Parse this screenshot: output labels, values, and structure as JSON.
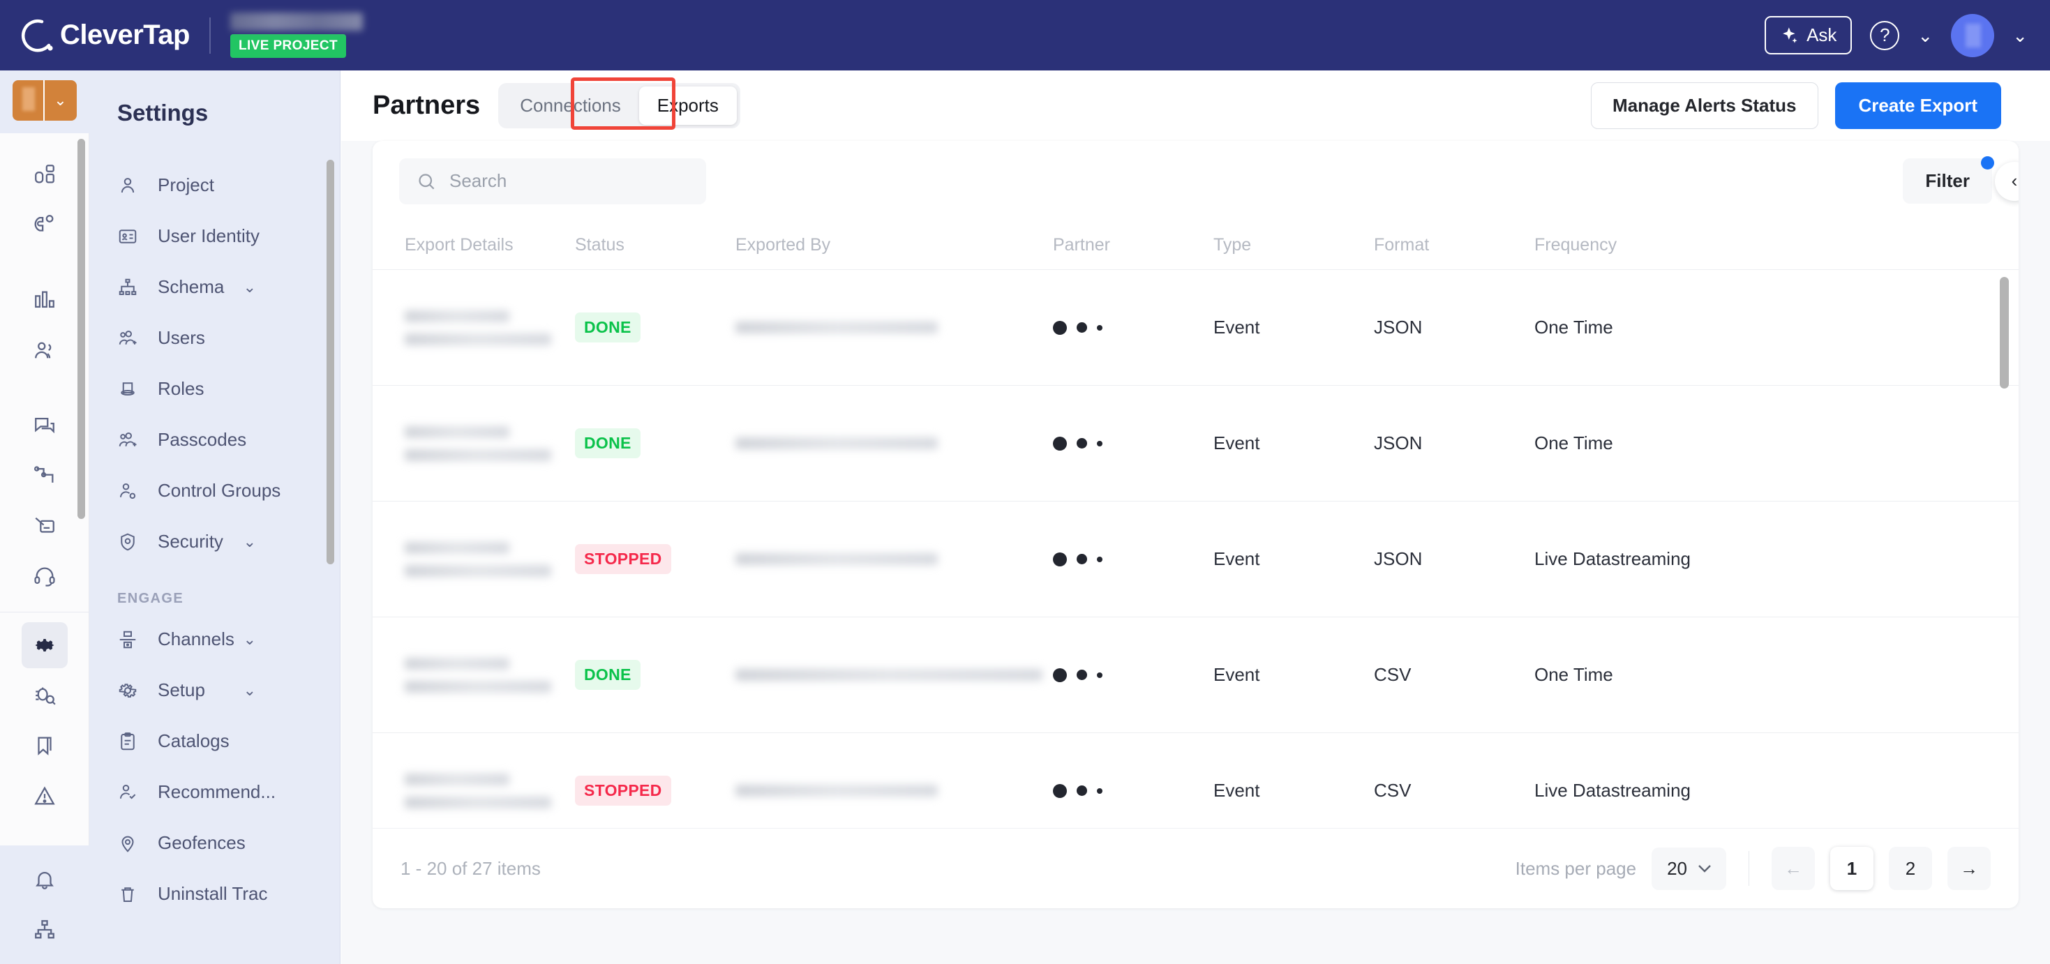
{
  "topbar": {
    "brand": "CleverTap",
    "project_badge": "LIVE PROJECT",
    "ask_label": "Ask",
    "icons": {
      "sparkle": "sparkle-icon",
      "help": "?",
      "chevron": "˅"
    }
  },
  "settings_sidebar": {
    "title": "Settings",
    "items": [
      {
        "label": "Project",
        "icon": "user-icon",
        "expandable": false
      },
      {
        "label": "User Identity",
        "icon": "id-card-icon",
        "expandable": false
      },
      {
        "label": "Schema",
        "icon": "schema-icon",
        "expandable": true
      },
      {
        "label": "Users",
        "icon": "users-add-icon",
        "expandable": false
      },
      {
        "label": "Roles",
        "icon": "hat-icon",
        "expandable": false
      },
      {
        "label": "Passcodes",
        "icon": "users-add-icon",
        "expandable": false
      },
      {
        "label": "Control Groups",
        "icon": "user-gear-icon",
        "expandable": false
      },
      {
        "label": "Security",
        "icon": "shield-lock-icon",
        "expandable": true
      }
    ],
    "group_label": "ENGAGE",
    "engage_items": [
      {
        "label": "Channels",
        "icon": "channels-icon",
        "expandable": true
      },
      {
        "label": "Setup",
        "icon": "gear-icon",
        "expandable": true
      },
      {
        "label": "Catalogs",
        "icon": "clipboard-icon",
        "expandable": false
      },
      {
        "label": "Recommend...",
        "icon": "user-check-icon",
        "expandable": false
      },
      {
        "label": "Geofences",
        "icon": "map-pin-icon",
        "expandable": false
      },
      {
        "label": "Uninstall Trac",
        "icon": "trash-icon",
        "expandable": false
      }
    ]
  },
  "rail": {
    "icons": [
      "dashboard-icon",
      "magnet-icon",
      "bar-chart-icon",
      "people-icon",
      "messages-icon",
      "flow-icon",
      "campaign-icon",
      "headset-icon"
    ],
    "bottom_icons": [
      "gear-icon",
      "debug-icon",
      "bookmark-icon",
      "alert-icon"
    ],
    "footer_icons": [
      "bell-icon",
      "sitemap-icon"
    ],
    "active": "gear-icon"
  },
  "page": {
    "title": "Partners",
    "tabs": [
      {
        "label": "Connections",
        "active": false
      },
      {
        "label": "Exports",
        "active": true
      }
    ],
    "highlighted_tab": "Exports",
    "highlight_color": "#f04438",
    "actions": {
      "manage_alerts": "Manage Alerts Status",
      "create_export": "Create Export"
    }
  },
  "toolbar": {
    "search_placeholder": "Search",
    "search_value": "",
    "filter_label": "Filter",
    "filter_has_badge": true,
    "collapse_icon": "chevron-left-icon"
  },
  "table": {
    "columns": [
      "Export Details",
      "Status",
      "Exported By",
      "Partner",
      "Type",
      "Format",
      "Frequency"
    ],
    "rows": [
      {
        "export_details": "",
        "status": "DONE",
        "exported_by": "",
        "partner": "",
        "type": "Event",
        "format": "JSON",
        "frequency": "One Time"
      },
      {
        "export_details": "",
        "status": "DONE",
        "exported_by": "",
        "partner": "",
        "type": "Event",
        "format": "JSON",
        "frequency": "One Time"
      },
      {
        "export_details": "",
        "status": "STOPPED",
        "exported_by": "",
        "partner": "",
        "type": "Event",
        "format": "JSON",
        "frequency": "Live Datastreaming"
      },
      {
        "export_details": "",
        "status": "DONE",
        "exported_by": "",
        "partner": "",
        "type": "Event",
        "format": "CSV",
        "frequency": "One Time"
      },
      {
        "export_details": "",
        "status": "STOPPED",
        "exported_by": "",
        "partner": "",
        "type": "Event",
        "format": "CSV",
        "frequency": "Live Datastreaming"
      }
    ],
    "status_colors": {
      "DONE": "#0ac24a",
      "STOPPED": "#f5294b"
    }
  },
  "footer": {
    "count_text": "1 - 20 of 27 items",
    "items_per_page_label": "Items per page",
    "items_per_page_value": "20",
    "prev_icon": "←",
    "next_icon": "→",
    "pages": [
      "1",
      "2"
    ],
    "current_page": "1"
  }
}
